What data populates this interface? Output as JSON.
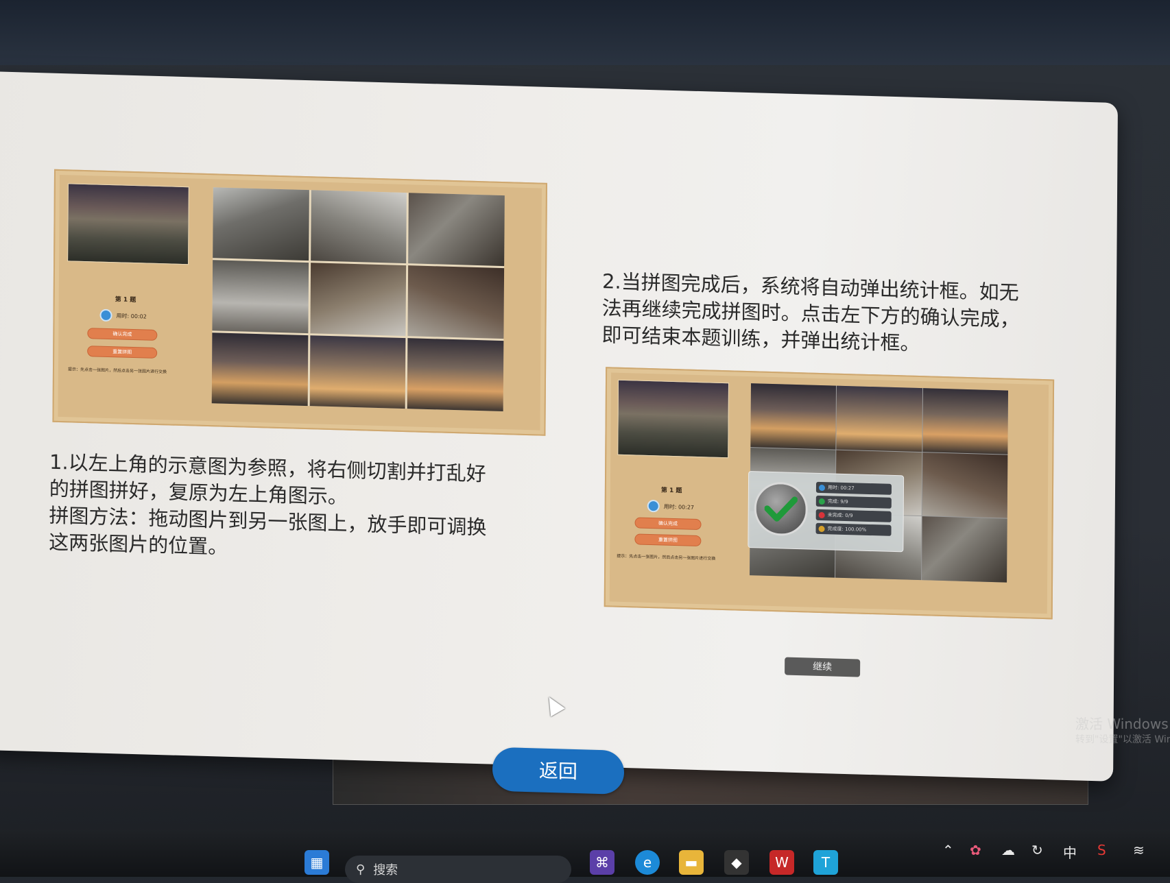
{
  "app": {
    "dialog": {
      "step1": {
        "text_line1": "1.以左上角的示意图为参照，将右侧切割并打乱好",
        "text_line2": "的拼图拼好，复原为左上角图示。",
        "text_line3": "拼图方法：拖动图片到另一张图上，放手即可调换",
        "text_line4": "这两张图片的位置。",
        "preview": {
          "level": "第 1 题",
          "timer": "用时: 00:02",
          "confirm_button": "确认完成",
          "reset_button": "重置拼图",
          "tip": "提示：先点击一张图片，然后点击另一张图片进行交换"
        }
      },
      "step2": {
        "text_line1": "2.当拼图完成后，系统将自动弹出统计框。如无",
        "text_line2": "法再继续完成拼图时。点击左下方的确认完成，",
        "text_line3": "即可结束本题训练，并弹出统计框。",
        "preview": {
          "level": "第 1 题",
          "timer": "用时: 00:27",
          "confirm_button": "确认完成",
          "reset_button": "重置拼图",
          "tip": "提示：先点击一张图片，然后点击另一张图片进行交换",
          "stats": {
            "time": "用时: 00:27",
            "done": "完成: 9/9",
            "undone": "未完成: 0/9",
            "rate": "完成度: 100.00%"
          },
          "continue_button": "继续"
        }
      },
      "back_button": "返回"
    }
  },
  "watermark": {
    "line1": "激活 Windows",
    "line2": "转到\"设置\"以激活 Windows"
  },
  "taskbar": {
    "search_placeholder": "搜索",
    "ime": "中",
    "icons": [
      "windows-start-icon",
      "search-icon",
      "visual-studio-icon",
      "edge-icon",
      "file-explorer-icon",
      "app-icon",
      "wps-icon",
      "app-t-icon"
    ],
    "tray_icons": [
      "chevron-up-icon",
      "app-tray-icon",
      "cloud-icon",
      "sync-icon",
      "wps-tray-icon",
      "wifi-icon"
    ]
  },
  "colors": {
    "back_button": "#1b6fbf",
    "panel": "#d9b988",
    "mini_button": "#e17f4d"
  }
}
